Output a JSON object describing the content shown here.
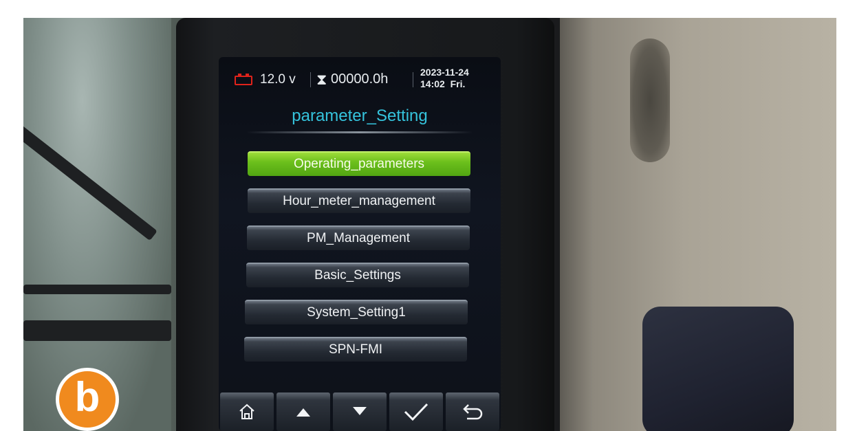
{
  "status": {
    "voltage": "12.0 v",
    "hours": "00000.0h",
    "date": "2023-11-24",
    "time_day": "14:02  Fri."
  },
  "header": {
    "title": "parameter_Setting"
  },
  "menu": {
    "items": [
      {
        "label": "Operating_parameters",
        "selected": true
      },
      {
        "label": "Hour_meter_management",
        "selected": false
      },
      {
        "label": "PM_Management",
        "selected": false
      },
      {
        "label": "Basic_Settings",
        "selected": false
      },
      {
        "label": "System_Setting1",
        "selected": false
      },
      {
        "label": "SPN-FMI",
        "selected": false
      }
    ]
  },
  "nav": {
    "buttons": [
      "home-icon",
      "up-arrow-icon",
      "down-arrow-icon",
      "check-icon",
      "back-icon"
    ]
  },
  "badge": {
    "label": "b"
  },
  "colors": {
    "accent_title": "#35c3dc",
    "selected_item": "#6cc01c",
    "battery": "#e0231b",
    "badge": "#f08a1e"
  }
}
